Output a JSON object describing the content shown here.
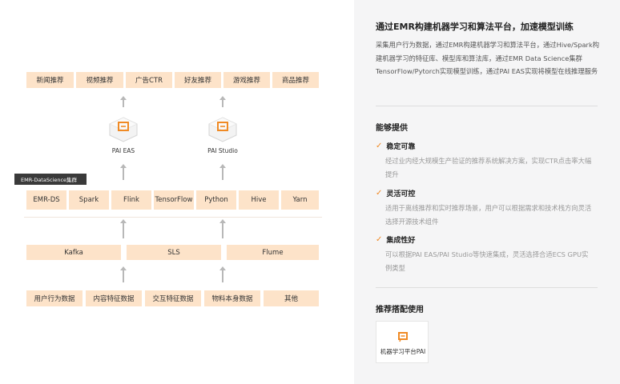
{
  "diagram": {
    "top_row": [
      "新闻推荐",
      "视频推荐",
      "广告CTR",
      "好友推荐",
      "游戏推荐",
      "商品推荐"
    ],
    "services": [
      {
        "label": "PAI EAS",
        "icon": "pai-eas-icon"
      },
      {
        "label": "PAI Studio",
        "icon": "pai-studio-icon"
      }
    ],
    "cluster_tag": "EMR-DataScience集群",
    "compute_row": [
      "EMR-DS",
      "Spark",
      "Flink",
      "TensorFlow",
      "Python",
      "Hive",
      "Yarn"
    ],
    "ingest_row": [
      "Kafka",
      "SLS",
      "Flume"
    ],
    "source_row": [
      "用户行为数据",
      "内容特征数据",
      "交互特征数据",
      "物料本身数据",
      "其他"
    ]
  },
  "panel": {
    "title": "通过EMR构建机器学习和算法平台，加速模型训练",
    "description": "采集用户行为数据，通过EMR构建机器学习和算法平台，通过Hive/Spark构建机器学习的特征库、模型库和算法库，通过EMR Data Science集群TensorFlow/Pytorch实现模型训练，通过PAI EAS实现将模型在线推理服务",
    "capabilities_title": "能够提供",
    "features": [
      {
        "title": "稳定可靠",
        "desc": "经过业内经大规模生产验证的推荐系统解决方案，实现CTR点击率大幅提升"
      },
      {
        "title": "灵活可控",
        "desc": "适用于离线推荐和实时推荐场景，用户可以根据需求和技术栈方向灵活选择开源技术组件"
      },
      {
        "title": "集成性好",
        "desc": "可以根据PAI EAS/PAI Studio等快速集成，灵活选择合适ECS GPU实例类型"
      }
    ],
    "recommend_title": "推荐搭配使用",
    "recommend_card": {
      "label": "机器学习平台PAI",
      "icon": "pai-platform-icon"
    }
  },
  "colors": {
    "box_fill": "#fde3c9",
    "accent": "#f08a24",
    "panel_bg": "#f5f5f6",
    "tag_bg": "#3a3a3a",
    "arrow": "#b8b8b8"
  }
}
